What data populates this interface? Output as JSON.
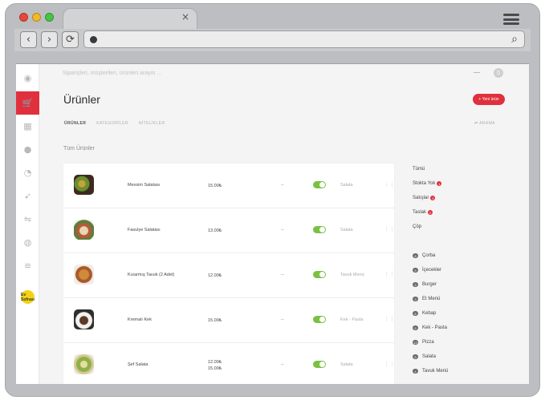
{
  "browser": {
    "tab_close": "×",
    "traffic_light_colors": [
      "#e8463b",
      "#f4b829",
      "#45c446"
    ]
  },
  "app": {
    "search_placeholder": "Siparişleri, müşterileri, ürünleri arayın ...",
    "notification_count": "0",
    "page_title": "Ürünler",
    "new_button": "+ Yeni ürün",
    "tabs": [
      "ÜRÜNLER",
      "KATEGORİLER",
      "NİTELİKLER"
    ],
    "active_tab": "ÜRÜNLER",
    "search_toggle": "ARAMA",
    "section_title": "Tüm Ürünler",
    "brand_logo_text": "Ev Sofrası",
    "accent_color": "#e0303e",
    "toggle_color": "#7ac143"
  },
  "sidebar": {
    "icons": [
      "globe-icon",
      "cart-icon",
      "dashboard-icon",
      "user-icon",
      "report-icon",
      "marketing-icon",
      "integration-icon",
      "new-icon",
      "menu-icon"
    ]
  },
  "products": [
    {
      "name": "Mevsim Salatası",
      "price": "15.00₺",
      "price2": "",
      "stock": "--",
      "active": true,
      "category": "Salata"
    },
    {
      "name": "Fasulye Salatası",
      "price": "13.00₺",
      "price2": "",
      "stock": "--",
      "active": true,
      "category": "Salata"
    },
    {
      "name": "Kızarmış Tavuk (2 Adet)",
      "price": "12.00₺",
      "price2": "",
      "stock": "--",
      "active": true,
      "category": "Tavuk Menü"
    },
    {
      "name": "Kremalı Kek",
      "price": "15.00₺",
      "price2": "",
      "stock": "--",
      "active": true,
      "category": "Kek - Pasta"
    },
    {
      "name": "Şef Salata",
      "price": "12.00₺",
      "price2": "15.00₺",
      "stock": "--",
      "active": true,
      "category": "Salata"
    }
  ],
  "status_filters": [
    {
      "label": "Tümü",
      "count": ""
    },
    {
      "label": "Stokta Yok",
      "count": "1"
    },
    {
      "label": "Satışlar",
      "count": "3"
    },
    {
      "label": "Taslak",
      "count": "2"
    },
    {
      "label": "Çöp",
      "count": ""
    }
  ],
  "category_filters": [
    {
      "label": "Çorba",
      "count": "6"
    },
    {
      "label": "İçecekler",
      "count": "5"
    },
    {
      "label": "Burger",
      "count": "3"
    },
    {
      "label": "Et Menü",
      "count": "3"
    },
    {
      "label": "Kebap",
      "count": "6"
    },
    {
      "label": "Kek - Pasta",
      "count": "5"
    },
    {
      "label": "Pizza",
      "count": "12"
    },
    {
      "label": "Salata",
      "count": "5"
    },
    {
      "label": "Tavuk Menü",
      "count": "4"
    }
  ]
}
